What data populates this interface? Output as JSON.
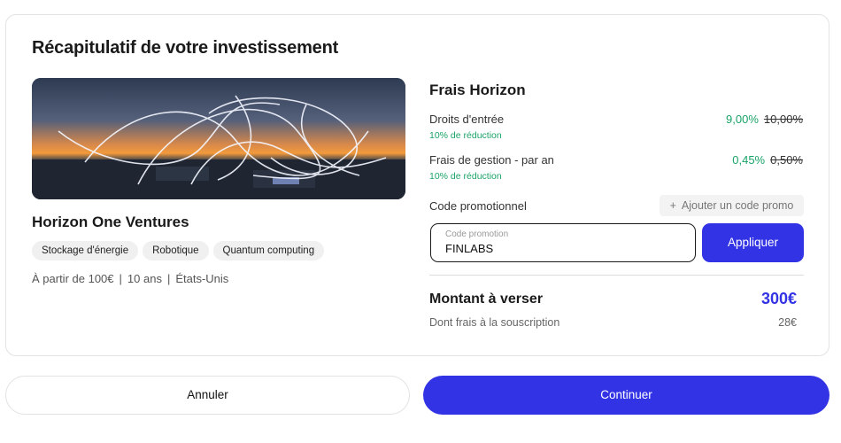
{
  "summary": {
    "title": "Récapitulatif de votre investissement"
  },
  "fund": {
    "name": "Horizon One Ventures",
    "tags": [
      "Stockage d'énergie",
      "Robotique",
      "Quantum computing"
    ],
    "min_investment": "À partir de 100€",
    "duration": "10 ans",
    "country": "États-Unis",
    "separator": "|"
  },
  "fees": {
    "title": "Frais Horizon",
    "entry": {
      "label": "Droits d'entrée",
      "discount": "10% de réduction",
      "new_rate": "9,00%",
      "old_rate": "10,00%"
    },
    "management": {
      "label": "Frais de gestion - par an",
      "discount": "10% de réduction",
      "new_rate": "0,45%",
      "old_rate": "0,50%"
    }
  },
  "promo": {
    "label": "Code promotionnel",
    "add_label": "Ajouter un code promo",
    "placeholder": "Code promotion",
    "value": "FINLABS",
    "apply_label": "Appliquer"
  },
  "total": {
    "label": "Montant à verser",
    "value": "300€",
    "subscription_label": "Dont frais à la souscription",
    "subscription_value": "28€"
  },
  "actions": {
    "cancel_label": "Annuler",
    "continue_label": "Continuer"
  },
  "colors": {
    "accent": "#3333e6",
    "discount_green": "#1aa367"
  },
  "icons": {
    "plus": "plus-icon"
  }
}
